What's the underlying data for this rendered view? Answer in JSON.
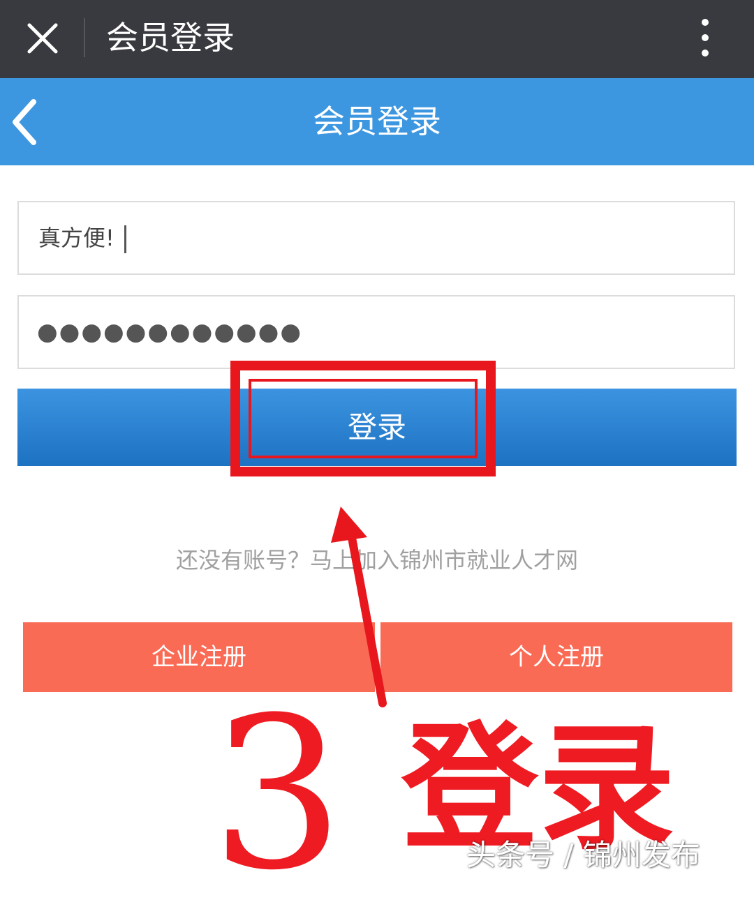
{
  "topbar": {
    "title": "会员登录",
    "close_icon": "close-icon",
    "more_icon": "more-vertical-icon"
  },
  "header": {
    "title": "会员登录",
    "back_icon": "chevron-left-icon"
  },
  "form": {
    "username_value": "真方便!",
    "password_value": "●●●●●●●●●●●●",
    "login_label": "登录"
  },
  "register": {
    "hint": "还没有账号？马上加入锦州市就业人才网",
    "company_label": "企业注册",
    "personal_label": "个人注册"
  },
  "annotation": {
    "step_number": "3",
    "step_text": "登录",
    "color": "#ef1b22"
  },
  "watermark": "头条号 / 锦州发布",
  "colors": {
    "topbar": "#393a3f",
    "header": "#3d97e0",
    "login_button": "#1d72c2",
    "register_button": "#fa6b55"
  }
}
